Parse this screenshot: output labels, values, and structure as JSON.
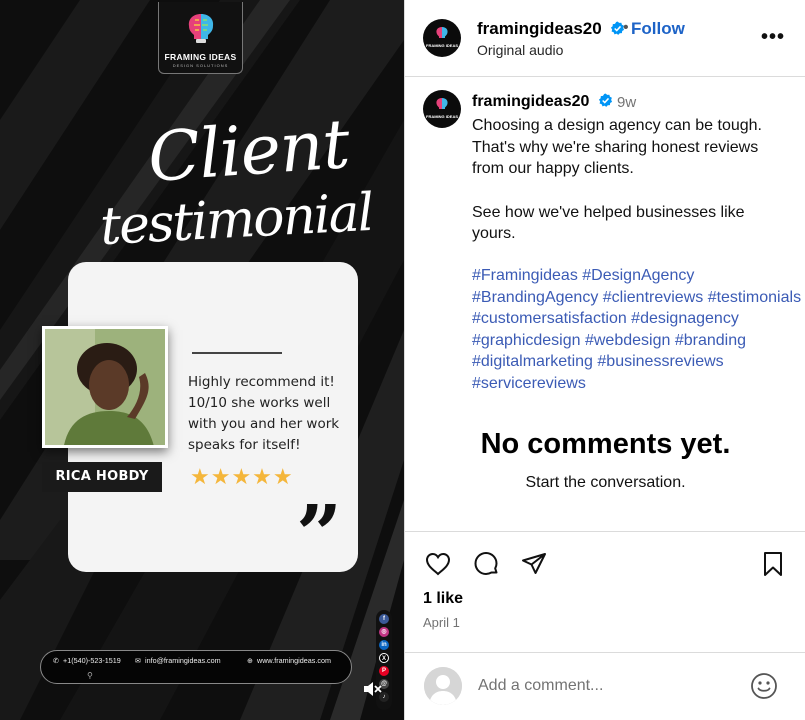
{
  "media": {
    "logo_title": "FRAMING IDEAS",
    "logo_subtitle": "DESIGN SOLUTIONS",
    "heading_line1": "Client",
    "heading_line2": "testimonial",
    "quote": "Highly recommend it! 10/10 she works well with you and her work speaks for itself!",
    "stars": "★★★★★",
    "quote_mark": "”",
    "client_name": "RICA HOBDY",
    "phone": "+1(540)-523-1519",
    "email": "info@framingideas.com",
    "website": "www.framingideas.com",
    "rating": 5
  },
  "header": {
    "avatar_text": "FRAMING IDEAS",
    "username": "framingideas20",
    "dot": "•",
    "follow": "Follow",
    "audio": "Original audio",
    "more": "•••"
  },
  "caption": {
    "username": "framingideas20",
    "time": "9w",
    "line1": "Choosing a design agency can be tough. That's why we're sharing honest reviews from our happy clients.",
    "line2": "See how we've helped businesses like yours.",
    "hashtags": "#Framingideas #DesignAgency #BrandingAgency #clientreviews #testimonials #customersatisfaction #designagency #graphicdesign #webdesign #branding #digitalmarketing #businessreviews #servicereviews"
  },
  "comments": {
    "empty_title": "No comments yet.",
    "empty_sub": "Start the conversation."
  },
  "stats": {
    "likes": "1 like",
    "date": "April 1"
  },
  "comment_box": {
    "placeholder": "Add a comment..."
  },
  "colors": {
    "link": "#3b5bb5",
    "follow": "#1d63c7",
    "verified": "#0095f6",
    "stars": "#f4b63b"
  }
}
